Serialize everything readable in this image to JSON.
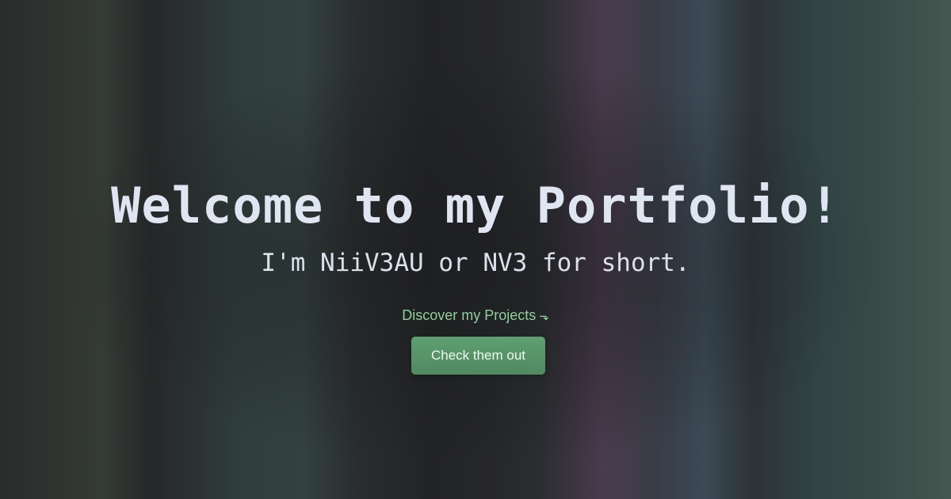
{
  "hero": {
    "title": "Welcome to my Portfolio!",
    "subtitle": "I'm NiiV3AU or NV3 for short.",
    "discover_text": "Discover my Projects",
    "discover_arrow": "⬎",
    "discover_arrow_icon": "arrow-down-right-icon",
    "cta_label": "Check them out"
  },
  "colors": {
    "title": "#dfe6f2",
    "accent": "#8fd09a",
    "button": "#5a9a6b"
  }
}
